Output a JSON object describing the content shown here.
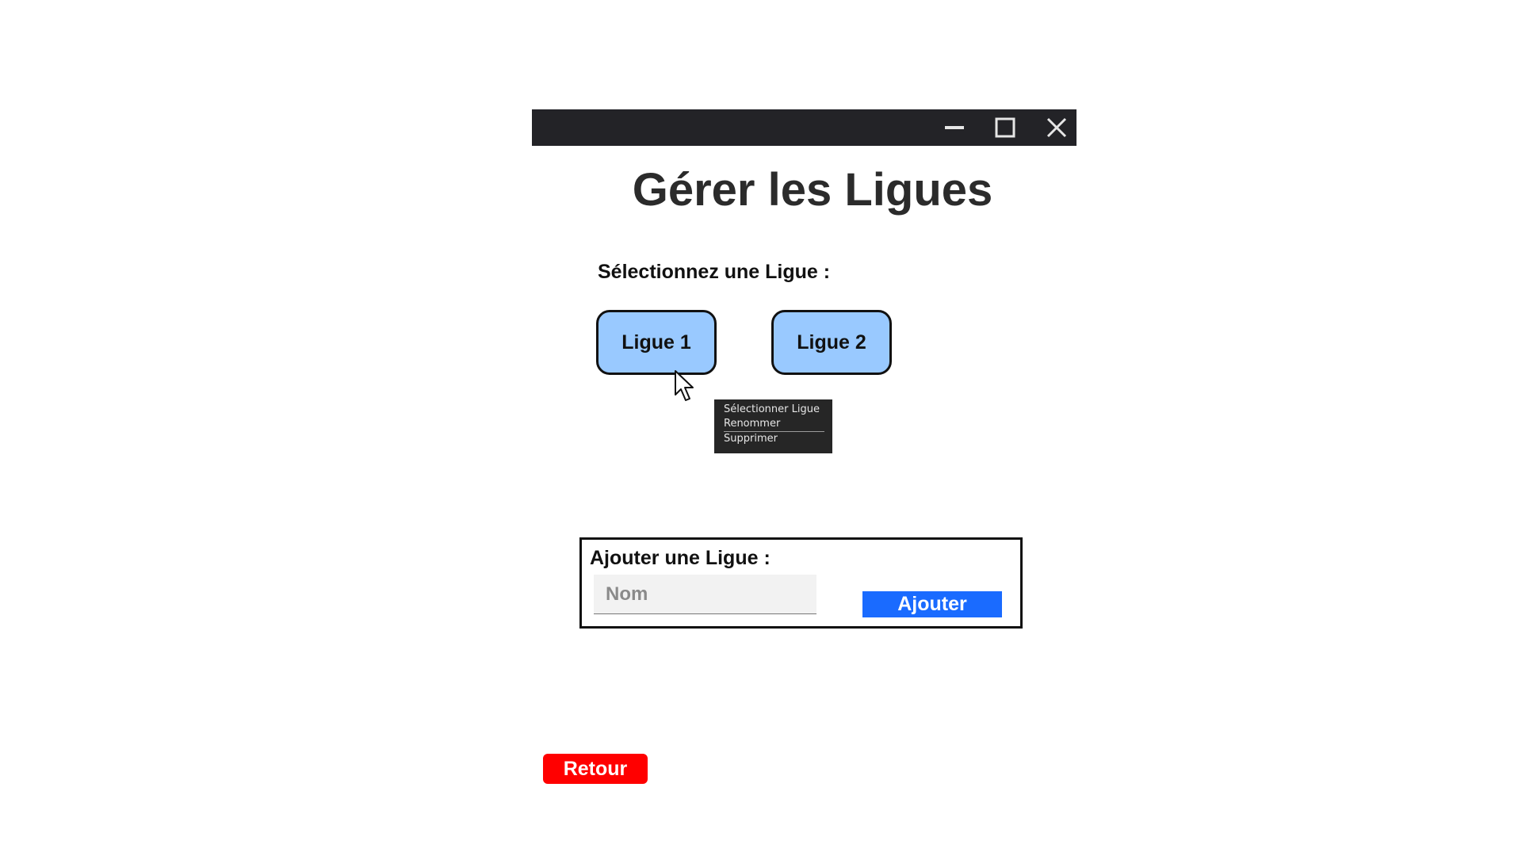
{
  "window": {
    "minimize_icon": "minimize-icon",
    "maximize_icon": "maximize-icon",
    "close_icon": "close-icon",
    "titlebar_color": "#232327"
  },
  "page": {
    "title": "Gérer les Ligues"
  },
  "select_section": {
    "label": "Sélectionnez une Ligue :",
    "leagues": [
      {
        "label": "Ligue 1"
      },
      {
        "label": "Ligue 2"
      }
    ],
    "league_button_color": "#99c9ff"
  },
  "context_menu": {
    "items": [
      {
        "label": "Sélectionner Ligue"
      },
      {
        "label": "Renommer"
      },
      {
        "label": "Supprimer"
      }
    ]
  },
  "add_section": {
    "label": "Ajouter une Ligue :",
    "name_input": {
      "value": "",
      "placeholder": "Nom"
    },
    "add_button_label": "Ajouter",
    "add_button_color": "#1a6bff"
  },
  "footer": {
    "back_button_label": "Retour",
    "back_button_color": "#ff0000"
  },
  "cursor": {
    "icon": "mouse-pointer-icon"
  }
}
